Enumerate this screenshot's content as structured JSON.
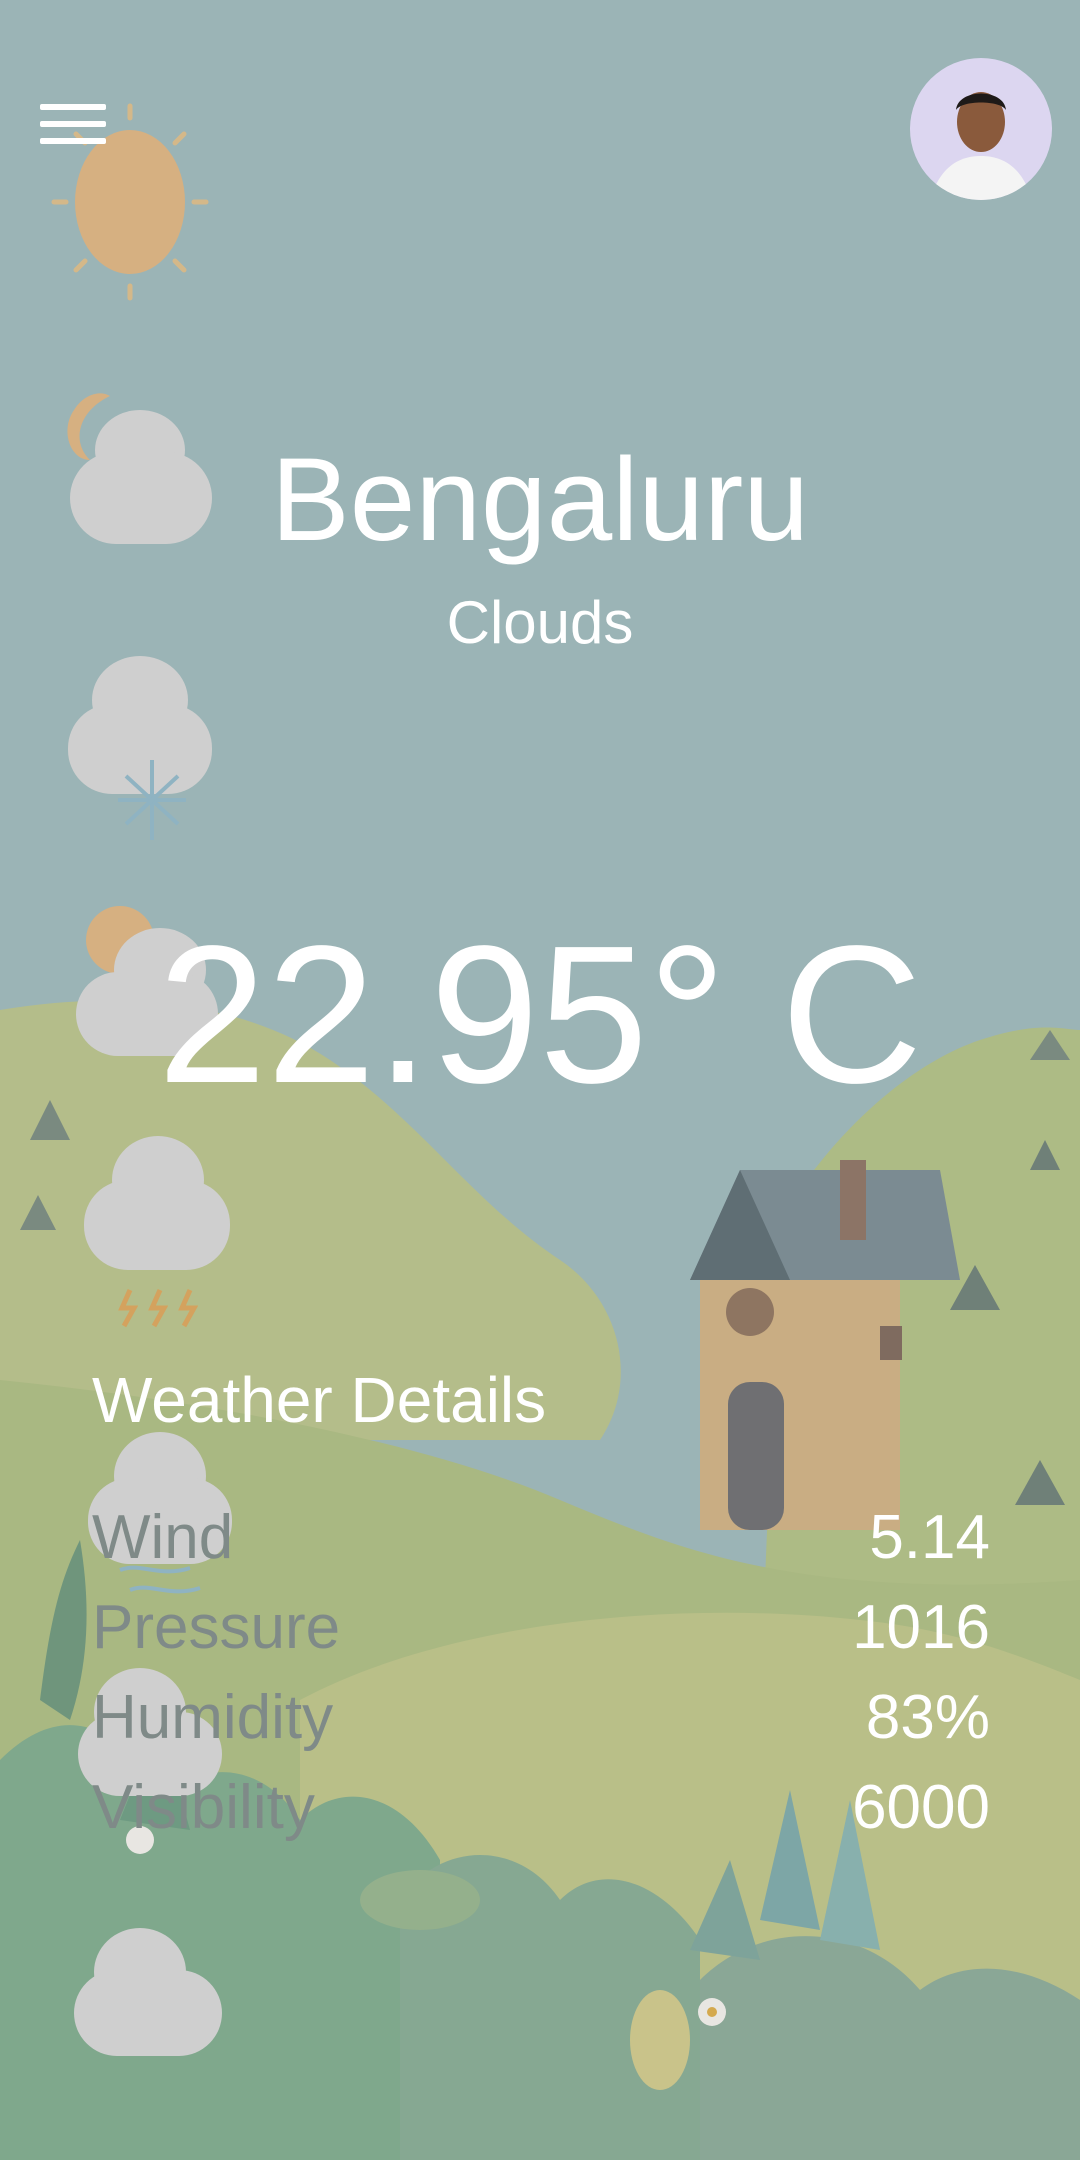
{
  "header": {
    "menu_icon": "hamburger-menu-icon",
    "avatar_icon": "user-avatar"
  },
  "weather": {
    "city": "Bengaluru",
    "condition": "Clouds",
    "temperature": "22.95° C"
  },
  "details": {
    "title": "Weather Details",
    "rows": [
      {
        "label": "Wind",
        "value": "5.14"
      },
      {
        "label": "Pressure",
        "value": "1016"
      },
      {
        "label": "Humidity",
        "value": "83%"
      },
      {
        "label": "Visibility",
        "value": "6000"
      }
    ]
  },
  "decorative_icons": [
    "sun-icon",
    "moon-cloud-icon",
    "snow-cloud-icon",
    "sun-cloud-icon",
    "thunder-cloud-icon",
    "wind-cloud-icon",
    "flower-cloud-icon",
    "cloud-icon"
  ],
  "colors": {
    "sky": "#9bb4b6",
    "hills": "#b8c08c",
    "text": "#ffffff",
    "label_gray": "#7f8a88"
  }
}
